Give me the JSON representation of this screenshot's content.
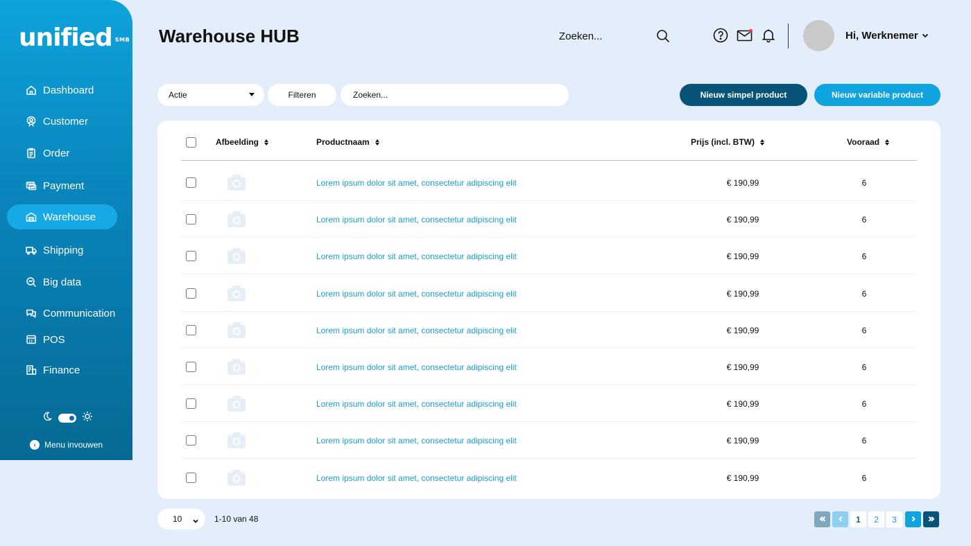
{
  "brand": {
    "name": "unified",
    "tag": "SMB"
  },
  "sidebar": {
    "items": [
      {
        "label": "Dashboard",
        "icon": "home-icon"
      },
      {
        "label": "Customer",
        "icon": "customer-icon"
      },
      {
        "label": "Order",
        "icon": "clipboard-icon"
      },
      {
        "label": "Payment",
        "icon": "payment-icon"
      },
      {
        "label": "Warehouse",
        "icon": "warehouse-icon",
        "active": true
      },
      {
        "label": "Shipping",
        "icon": "truck-icon"
      },
      {
        "label": "Big data",
        "icon": "analytics-icon"
      },
      {
        "label": "Communication",
        "icon": "chat-icon"
      },
      {
        "label": "POS",
        "icon": "register-icon"
      },
      {
        "label": "Finance",
        "icon": "finance-icon"
      }
    ],
    "collapse_label": "Menu invouwen"
  },
  "header": {
    "title": "Warehouse HUB",
    "search_label": "Zoeken...",
    "greeting": "Hi, Werknemer"
  },
  "toolbar": {
    "action_label": "Actie",
    "filter_label": "Filteren",
    "search_placeholder": "Zoeken...",
    "new_simple_label": "Nieuw simpel product",
    "new_variable_label": "Nieuw variable product"
  },
  "table": {
    "columns": {
      "image": "Afbeelding",
      "name": "Productnaam",
      "price": "Prijs (incl. BTW)",
      "stock": "Vooraad"
    },
    "rows": [
      {
        "name": "Lorem ipsum dolor sit amet, consectetur adipiscing elit",
        "price": "€ 190,99",
        "stock": "6"
      },
      {
        "name": "Lorem ipsum dolor sit amet, consectetur adipiscing elit",
        "price": "€ 190,99",
        "stock": "6"
      },
      {
        "name": "Lorem ipsum dolor sit amet, consectetur adipiscing elit",
        "price": "€ 190,99",
        "stock": "6"
      },
      {
        "name": "Lorem ipsum dolor sit amet, consectetur adipiscing elit",
        "price": "€ 190,99",
        "stock": "6"
      },
      {
        "name": "Lorem ipsum dolor sit amet, consectetur adipiscing elit",
        "price": "€ 190,99",
        "stock": "6"
      },
      {
        "name": "Lorem ipsum dolor sit amet, consectetur adipiscing elit",
        "price": "€ 190,99",
        "stock": "6"
      },
      {
        "name": "Lorem ipsum dolor sit amet, consectetur adipiscing elit",
        "price": "€ 190,99",
        "stock": "6"
      },
      {
        "name": "Lorem ipsum dolor sit amet, consectetur adipiscing elit",
        "price": "€ 190,99",
        "stock": "6"
      },
      {
        "name": "Lorem ipsum dolor sit amet, consectetur adipiscing elit",
        "price": "€ 190,99",
        "stock": "6"
      }
    ]
  },
  "pagination": {
    "per_page": "10",
    "range": "1-10 van 48",
    "pages": [
      "1",
      "2",
      "3"
    ],
    "current": "1"
  },
  "colors": {
    "accent": "#0fa3e0",
    "dark_accent": "#075478",
    "link": "#1a9dd0",
    "background": "#e4eefa"
  }
}
